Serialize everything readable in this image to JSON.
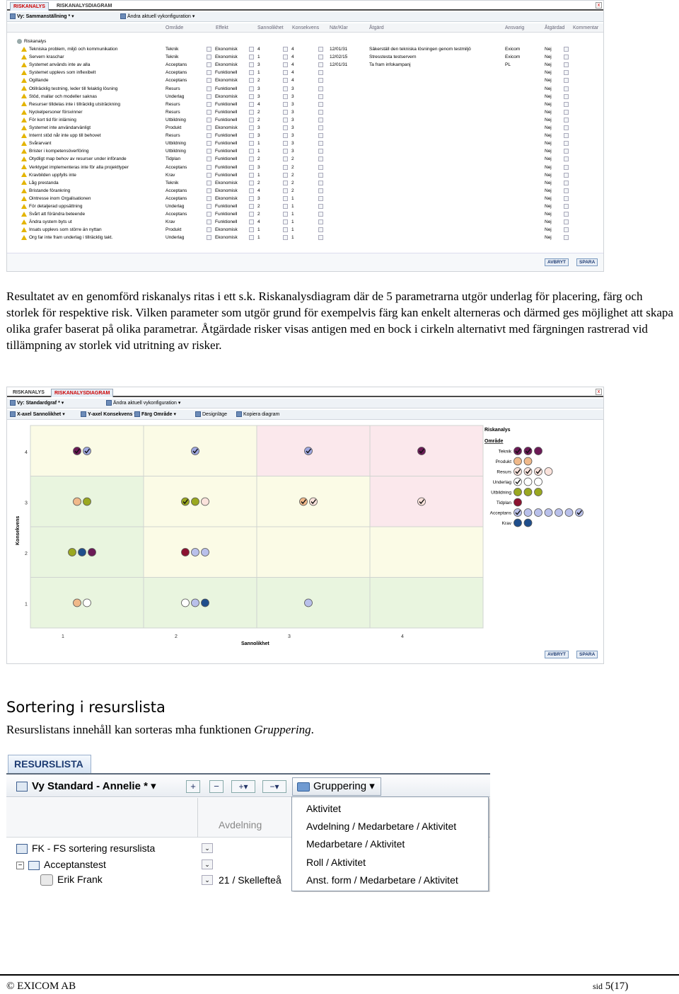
{
  "screenshot1": {
    "tabs": [
      "RISKANALYS",
      "RISKANALYSDIAGRAM"
    ],
    "close": "x",
    "toolbar": {
      "view": "Vy: Sammanställning *",
      "change": "Ändra aktuell vykonfiguration"
    },
    "columns": [
      "Område",
      "Effekt",
      "Sannolikhet",
      "Konsekvens",
      "När/Klar",
      "Åtgärd",
      "Ansvarig",
      "Åtgärdad",
      "Kommentar"
    ],
    "root": "Riskanalys",
    "rows": [
      {
        "name": "Tekniska problem, miljö och kommunikation",
        "area": "Teknik",
        "effect": "Ekonomisk",
        "prob": "4",
        "cons": "4",
        "date": "12/01/31",
        "action": "Säkerställ den tekniska lösningen genom testmiljö",
        "resp": "Exicom",
        "done": "Nej"
      },
      {
        "name": "Servern kraschar",
        "area": "Teknik",
        "effect": "Ekonomisk",
        "prob": "1",
        "cons": "4",
        "date": "12/02/15",
        "action": "Stresstesta testservern",
        "resp": "Exicom",
        "done": "Nej"
      },
      {
        "name": "Systemet används inte av alla",
        "area": "Acceptans",
        "effect": "Ekonomisk",
        "prob": "3",
        "cons": "4",
        "date": "12/01/31",
        "action": "Ta fram infokampanj",
        "resp": "PL",
        "done": "Nej"
      },
      {
        "name": "Systemet upplevs som inflexibelt",
        "area": "Acceptans",
        "effect": "Funktionell",
        "prob": "1",
        "cons": "4",
        "date": "",
        "action": "",
        "resp": "",
        "done": "Nej"
      },
      {
        "name": "Ogillande",
        "area": "Acceptans",
        "effect": "Ekonomisk",
        "prob": "2",
        "cons": "4",
        "date": "",
        "action": "",
        "resp": "",
        "done": "Nej"
      },
      {
        "name": "Otillräcklig testning, leder till felaktig lösning",
        "area": "Resurs",
        "effect": "Funktionell",
        "prob": "3",
        "cons": "3",
        "date": "",
        "action": "",
        "resp": "",
        "done": "Nej"
      },
      {
        "name": "Stöd, mallar och modeller saknas",
        "area": "Underlag",
        "effect": "Ekonomisk",
        "prob": "3",
        "cons": "3",
        "date": "",
        "action": "",
        "resp": "",
        "done": "Nej"
      },
      {
        "name": "Resurser tilldelas inte i tillräcklig utsträckning",
        "area": "Resurs",
        "effect": "Funktionell",
        "prob": "4",
        "cons": "3",
        "date": "",
        "action": "",
        "resp": "",
        "done": "Nej"
      },
      {
        "name": "Nyckelpersoner försvinner",
        "area": "Resurs",
        "effect": "Funktionell",
        "prob": "2",
        "cons": "3",
        "date": "",
        "action": "",
        "resp": "",
        "done": "Nej"
      },
      {
        "name": "För kort tid för inlärning",
        "area": "Utbildning",
        "effect": "Funktionell",
        "prob": "2",
        "cons": "3",
        "date": "",
        "action": "",
        "resp": "",
        "done": "Nej"
      },
      {
        "name": "Systemet inte användarvänligt",
        "area": "Produkt",
        "effect": "Ekonomisk",
        "prob": "3",
        "cons": "3",
        "date": "",
        "action": "",
        "resp": "",
        "done": "Nej"
      },
      {
        "name": "Internt stöd når inte upp till behovet",
        "area": "Resurs",
        "effect": "Funktionell",
        "prob": "3",
        "cons": "3",
        "date": "",
        "action": "",
        "resp": "",
        "done": "Nej"
      },
      {
        "name": "Svårarvant",
        "area": "Utbildning",
        "effect": "Funktionell",
        "prob": "1",
        "cons": "3",
        "date": "",
        "action": "",
        "resp": "",
        "done": "Nej"
      },
      {
        "name": "Brister i kompetensöverföring",
        "area": "Utbildning",
        "effect": "Funktionell",
        "prob": "1",
        "cons": "3",
        "date": "",
        "action": "",
        "resp": "",
        "done": "Nej"
      },
      {
        "name": "Otydligt map behov av resurser under införande",
        "area": "Tidplan",
        "effect": "Funktionell",
        "prob": "2",
        "cons": "2",
        "date": "",
        "action": "",
        "resp": "",
        "done": "Nej"
      },
      {
        "name": "Verktyget implementeras inte för alla projekttyper",
        "area": "Acceptans",
        "effect": "Funktionell",
        "prob": "3",
        "cons": "2",
        "date": "",
        "action": "",
        "resp": "",
        "done": "Nej"
      },
      {
        "name": "Kravbilden uppfylls inte",
        "area": "Krav",
        "effect": "Funktionell",
        "prob": "1",
        "cons": "2",
        "date": "",
        "action": "",
        "resp": "",
        "done": "Nej"
      },
      {
        "name": "Låg prestanda",
        "area": "Teknik",
        "effect": "Ekonomisk",
        "prob": "2",
        "cons": "2",
        "date": "",
        "action": "",
        "resp": "",
        "done": "Nej"
      },
      {
        "name": "Bristande förankring",
        "area": "Acceptans",
        "effect": "Ekonomisk",
        "prob": "4",
        "cons": "2",
        "date": "",
        "action": "",
        "resp": "",
        "done": "Nej"
      },
      {
        "name": "Ointresse inom Orgalisationen",
        "area": "Acceptans",
        "effect": "Ekonomisk",
        "prob": "3",
        "cons": "1",
        "date": "",
        "action": "",
        "resp": "",
        "done": "Nej"
      },
      {
        "name": "För detaljerad uppsättning",
        "area": "Underlag",
        "effect": "Funktionell",
        "prob": "2",
        "cons": "1",
        "date": "",
        "action": "",
        "resp": "",
        "done": "Nej"
      },
      {
        "name": "Svårt att förändra beteende",
        "area": "Acceptans",
        "effect": "Funktionell",
        "prob": "2",
        "cons": "1",
        "date": "",
        "action": "",
        "resp": "",
        "done": "Nej"
      },
      {
        "name": "Ändra system byts ut",
        "area": "Krav",
        "effect": "Funktionell",
        "prob": "4",
        "cons": "1",
        "date": "",
        "action": "",
        "resp": "",
        "done": "Nej"
      },
      {
        "name": "Insats upplevs som större än nyttan",
        "area": "Produkt",
        "effect": "Ekonomisk",
        "prob": "1",
        "cons": "1",
        "date": "",
        "action": "",
        "resp": "",
        "done": "Nej"
      },
      {
        "name": "Org far inte fram underlag i tillräcklig takt.",
        "area": "Underlag",
        "effect": "Ekonomisk",
        "prob": "1",
        "cons": "1",
        "date": "",
        "action": "",
        "resp": "",
        "done": "Nej"
      }
    ],
    "buttons": {
      "cancel": "AVBRYT",
      "save": "SPARA"
    }
  },
  "caption": "Resultatet av en genomförd riskanalys ritas i ett s.k. Riskanalysdiagram där de 5 parametrarna utgör underlag för placering, färg och storlek för respektive risk. Vilken parameter som utgör grund för exempelvis färg kan enkelt alterneras och därmed ges möjlighet att skapa olika grafer baserat på olika parametrar. Åtgärdade risker visas antigen med en bock i cirkeln alternativt med färgningen rastrerad vid tillämpning av storlek vid utritning av risker.",
  "screenshot2": {
    "tabs": [
      "RISKANALYS",
      "RISKANALYSDIAGRAM"
    ],
    "close": "x",
    "toolbar1": {
      "view": "Vy: Standardgraf *",
      "change": "Ändra aktuell vykonfiguration"
    },
    "toolbar2": {
      "xaxis": "X-axel Sannolikhet",
      "yaxis": "Y-axel Konsekvens",
      "color": "Färg Område",
      "design": "Designläge",
      "copy": "Kopiera diagram"
    },
    "buttons": {
      "cancel": "AVBRYT",
      "save": "SPARA"
    }
  },
  "chart_data": {
    "type": "scatter",
    "xlabel": "Sannolikhet",
    "ylabel": "Konsekvens",
    "x_ticks": [
      "1",
      "2",
      "3",
      "4"
    ],
    "y_ticks": [
      "1",
      "2",
      "3",
      "4"
    ],
    "cell_colors": [
      [
        "#e9f5df",
        "#e9f5df",
        "#e9f5df",
        "#e9f5df"
      ],
      [
        "#e9f5df",
        "#fbfbe6",
        "#fbfbe6",
        "#fbfbe6"
      ],
      [
        "#e9f5df",
        "#fbfbe6",
        "#fbfbe6",
        "#fbe8ec"
      ],
      [
        "#fbfbe6",
        "#fbfbe6",
        "#fbe8ec",
        "#fbe8ec"
      ]
    ],
    "cells": [
      {
        "x": 1,
        "y": 4,
        "markers": [
          {
            "color": "#6b1a56",
            "checked": true
          },
          {
            "color": "#9fa8e0",
            "checked": true
          }
        ]
      },
      {
        "x": 2,
        "y": 4,
        "markers": [
          {
            "color": "#9fa8e0",
            "checked": true
          }
        ]
      },
      {
        "x": 3,
        "y": 4,
        "markers": [
          {
            "color": "#9fa8e0",
            "checked": true
          }
        ]
      },
      {
        "x": 4,
        "y": 4,
        "markers": [
          {
            "color": "#6b1a56",
            "checked": true
          }
        ]
      },
      {
        "x": 1,
        "y": 3,
        "markers": [
          {
            "color": "#f0b98a",
            "checked": false
          },
          {
            "color": "#9aa820",
            "checked": false
          }
        ]
      },
      {
        "x": 2,
        "y": 3,
        "markers": [
          {
            "color": "#9aa820",
            "checked": true
          },
          {
            "color": "#9aa820",
            "checked": false
          },
          {
            "color": "#fbe3dc",
            "checked": false
          }
        ]
      },
      {
        "x": 3,
        "y": 3,
        "markers": [
          {
            "color": "#f0b98a",
            "checked": true
          },
          {
            "color": "#fbe3dc",
            "checked": true
          }
        ]
      },
      {
        "x": 4,
        "y": 3,
        "markers": [
          {
            "color": "#fbe3dc",
            "checked": true
          }
        ]
      },
      {
        "x": 1,
        "y": 2,
        "markers": [
          {
            "color": "#9aa820",
            "checked": false
          },
          {
            "color": "#1f4e8c",
            "checked": false
          },
          {
            "color": "#6b1a56",
            "checked": false
          }
        ]
      },
      {
        "x": 2,
        "y": 2,
        "markers": [
          {
            "color": "#8c1230",
            "checked": false
          },
          {
            "color": "#b9c0ea",
            "checked": false
          },
          {
            "color": "#b9c0ea",
            "checked": false
          }
        ]
      },
      {
        "x": 1,
        "y": 1,
        "markers": [
          {
            "color": "#f0b98a",
            "checked": false
          },
          {
            "color": "#ffffff",
            "checked": false
          }
        ]
      },
      {
        "x": 2,
        "y": 1,
        "markers": [
          {
            "color": "#ffffff",
            "checked": false
          },
          {
            "color": "#b9c0ea",
            "checked": false
          },
          {
            "color": "#1f4e8c",
            "checked": false
          }
        ]
      },
      {
        "x": 3,
        "y": 1,
        "markers": [
          {
            "color": "#b9c0ea",
            "checked": false
          }
        ]
      }
    ],
    "legend": {
      "title": "Riskanalys",
      "subtitle": "Område",
      "items": [
        {
          "label": "Teknik",
          "markers": [
            {
              "color": "#6b1a56",
              "checked": true
            },
            {
              "color": "#6b1a56",
              "checked": true
            },
            {
              "color": "#6b1a56",
              "checked": false
            }
          ]
        },
        {
          "label": "Produkt",
          "markers": [
            {
              "color": "#f0b98a",
              "checked": false
            },
            {
              "color": "#f0b98a",
              "checked": false
            }
          ]
        },
        {
          "label": "Resurs",
          "markers": [
            {
              "color": "#fbe3dc",
              "checked": true
            },
            {
              "color": "#fbe3dc",
              "checked": true
            },
            {
              "color": "#fbe3dc",
              "checked": true
            },
            {
              "color": "#fbe3dc",
              "checked": false
            }
          ]
        },
        {
          "label": "Underlag",
          "markers": [
            {
              "color": "#ffffff",
              "checked": true
            },
            {
              "color": "#ffffff",
              "checked": false
            },
            {
              "color": "#ffffff",
              "checked": false
            }
          ]
        },
        {
          "label": "Utbildning",
          "markers": [
            {
              "color": "#9aa820",
              "checked": false
            },
            {
              "color": "#9aa820",
              "checked": false
            },
            {
              "color": "#9aa820",
              "checked": false
            }
          ]
        },
        {
          "label": "Tidplan",
          "markers": [
            {
              "color": "#8c1230",
              "checked": false
            }
          ]
        },
        {
          "label": "Acceptans",
          "markers": [
            {
              "color": "#b9c0ea",
              "checked": true
            },
            {
              "color": "#b9c0ea",
              "checked": false
            },
            {
              "color": "#b9c0ea",
              "checked": false
            },
            {
              "color": "#b9c0ea",
              "checked": false
            },
            {
              "color": "#b9c0ea",
              "checked": false
            },
            {
              "color": "#b9c0ea",
              "checked": false
            },
            {
              "color": "#b9c0ea",
              "checked": true
            }
          ]
        },
        {
          "label": "Krav",
          "markers": [
            {
              "color": "#1f4e8c",
              "checked": false
            },
            {
              "color": "#1f4e8c",
              "checked": false
            }
          ]
        }
      ]
    }
  },
  "section": {
    "heading": "Sortering i resurslista",
    "text_before": "Resurslistans innehåll kan sorteras mha funktionen ",
    "text_italic": "Gruppering",
    "text_after": "."
  },
  "screenshot3": {
    "tab": "RESURSLISTA",
    "view": "Vy Standard - Annelie *",
    "grouping": "Gruppering",
    "column": "Avdelning",
    "rows": [
      {
        "label": "FK - FS sortering resurslista"
      },
      {
        "label": "Acceptanstest"
      },
      {
        "label": "Erik Frank",
        "value": "21 / Skellefteå"
      }
    ],
    "menu": [
      "Aktivitet",
      "Avdelning / Medarbetare / Aktivitet",
      "Medarbetare / Aktivitet",
      "Roll / Aktivitet",
      "Anst. form / Medarbetare / Aktivitet"
    ]
  },
  "footer": {
    "left": "© EXICOM AB",
    "right_prefix": "sid",
    "right_page": "5(17)"
  }
}
